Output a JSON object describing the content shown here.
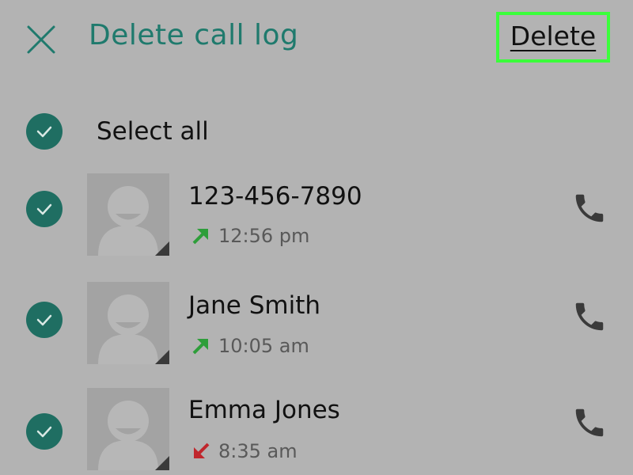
{
  "header": {
    "title": "Delete call log",
    "delete_label": "Delete",
    "close_icon": "close-icon"
  },
  "select_all": {
    "label": "Select all",
    "checked": true
  },
  "entries": [
    {
      "name": "123-456-7890",
      "time": "12:56 pm",
      "direction": "outgoing",
      "checked": true
    },
    {
      "name": "Jane Smith",
      "time": "10:05 am",
      "direction": "outgoing",
      "checked": true
    },
    {
      "name": "Emma Jones",
      "time": "8:35 am",
      "direction": "incoming",
      "checked": true
    }
  ],
  "colors": {
    "background": "#b3b3b3",
    "accent": "#1f7a6d",
    "check_fill": "#1f6e62",
    "highlight_border": "#3bff3b",
    "outgoing_arrow": "#2e9e3a",
    "incoming_arrow": "#c0262c"
  }
}
